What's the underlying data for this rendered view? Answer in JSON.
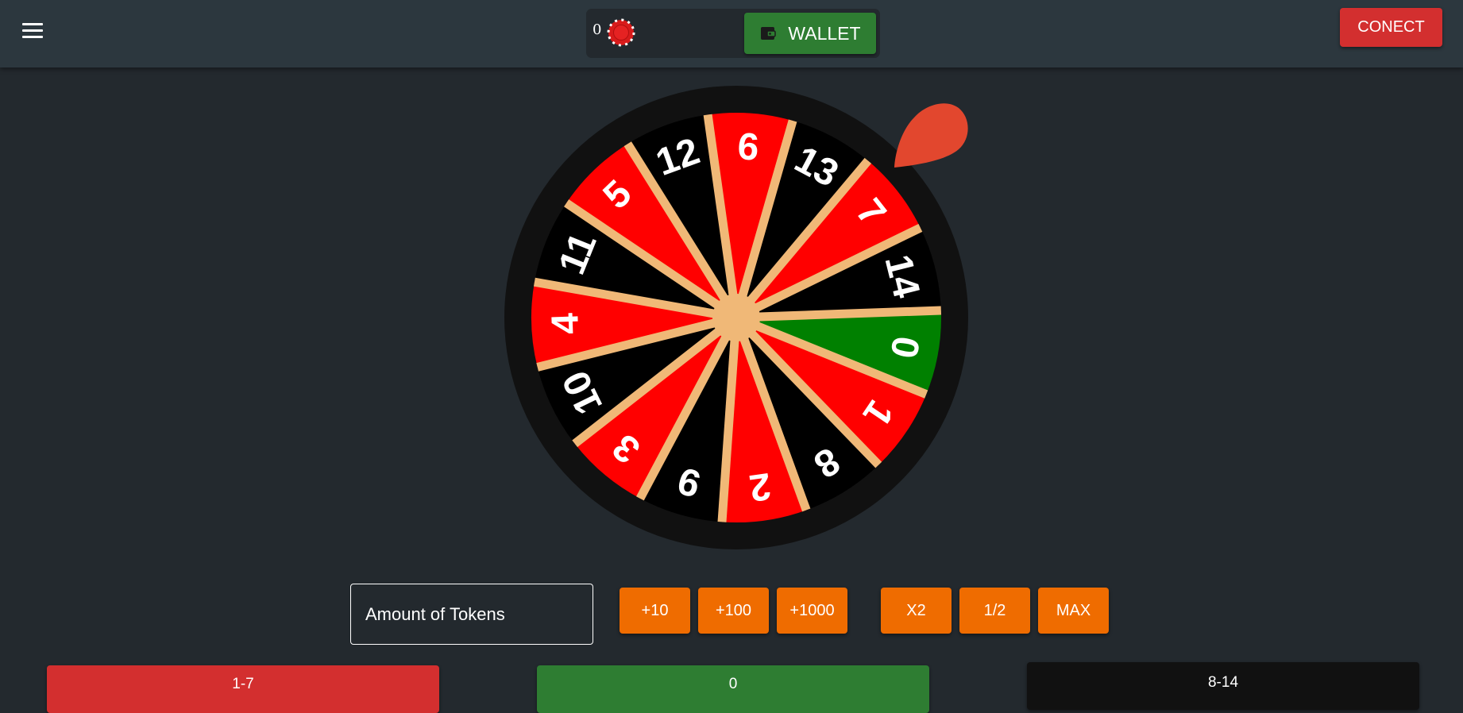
{
  "header": {
    "balance": "0",
    "wallet_label": "WALLET",
    "connect_label": "CONECT"
  },
  "wheel": {
    "segments": [
      {
        "label": "0",
        "color": "green"
      },
      {
        "label": "1",
        "color": "red"
      },
      {
        "label": "8",
        "color": "black"
      },
      {
        "label": "2",
        "color": "red"
      },
      {
        "label": "9",
        "color": "black"
      },
      {
        "label": "3",
        "color": "red"
      },
      {
        "label": "10",
        "color": "black"
      },
      {
        "label": "4",
        "color": "red"
      },
      {
        "label": "11",
        "color": "black"
      },
      {
        "label": "5",
        "color": "red"
      },
      {
        "label": "12",
        "color": "black"
      },
      {
        "label": "6",
        "color": "red"
      },
      {
        "label": "13",
        "color": "black"
      },
      {
        "label": "7",
        "color": "red"
      },
      {
        "label": "14",
        "color": "black"
      }
    ]
  },
  "bet": {
    "amount_placeholder": "Amount of Tokens",
    "add_buttons": [
      "+10",
      "+100",
      "+1000"
    ],
    "modifier_buttons": [
      "X2",
      "1/2",
      "MAX"
    ]
  },
  "choices": {
    "low_label": "1-7",
    "zero_label": "0",
    "high_label": "8-14"
  },
  "colors": {
    "red": "#ff0000",
    "black": "#000000",
    "green": "#008000",
    "separator": "#f0b877",
    "rim": "#111111",
    "pointer": "#e2472e",
    "wallet": "#2e7d32",
    "connect": "#d32f2f",
    "chip_button": "#ef6c00",
    "bet_low": "#d32f2f",
    "bet_zero": "#2e7d32",
    "bet_high": "#111111"
  }
}
